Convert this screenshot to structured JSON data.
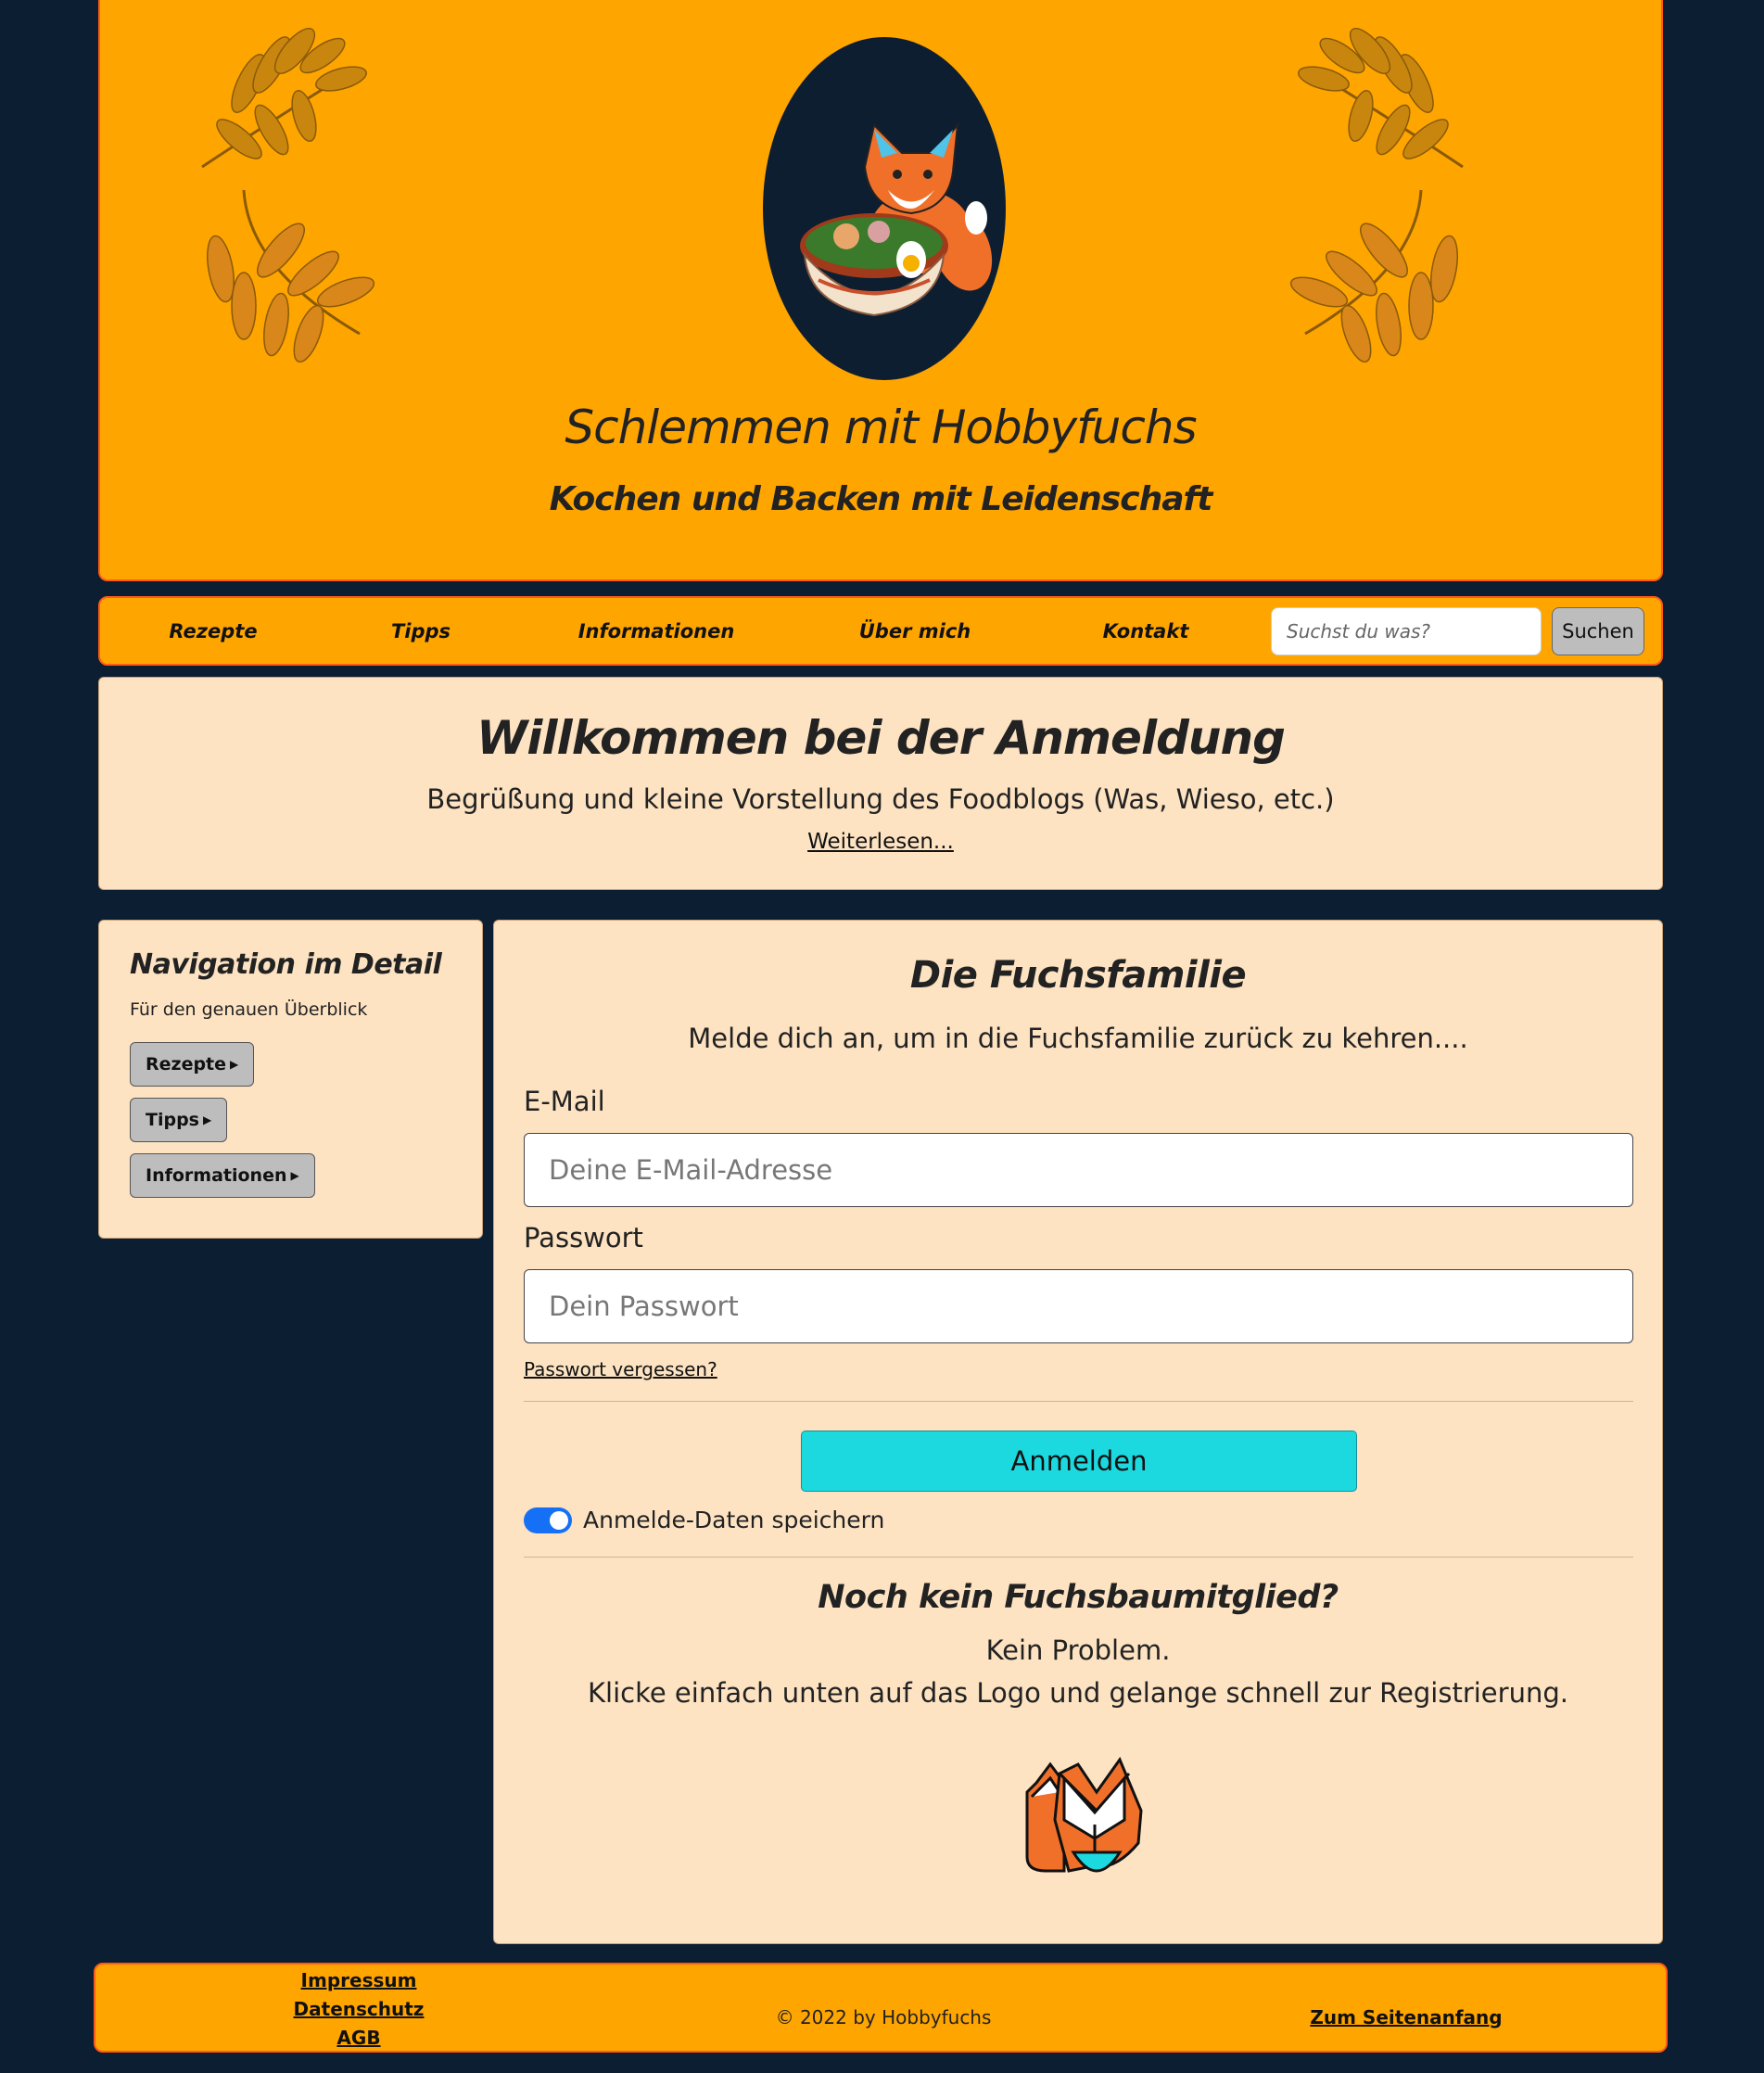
{
  "header": {
    "title": "Schlemmen mit Hobbyfuchs",
    "subtitle": "Kochen und Backen mit Leidenschaft",
    "logo_icon": "fox-eating-ramen-logo",
    "decoration_icon": "autumn-leaves"
  },
  "nav": {
    "items": [
      {
        "label": "Rezepte"
      },
      {
        "label": "Tipps"
      },
      {
        "label": "Informationen"
      },
      {
        "label": "Über mich"
      },
      {
        "label": "Kontakt"
      }
    ],
    "search_placeholder": "Suchst du was?",
    "search_button": "Suchen"
  },
  "welcome": {
    "title": "Willkommen bei der Anmeldung",
    "text": "Begrüßung und kleine Vorstellung des Foodblogs (Was, Wieso, etc.)",
    "link": "Weiterlesen..."
  },
  "sidebar": {
    "title": "Navigation im Detail",
    "subtitle": "Für den genauen Überblick",
    "buttons": [
      {
        "label": "Rezepte"
      },
      {
        "label": "Tipps"
      },
      {
        "label": "Informationen"
      }
    ]
  },
  "login": {
    "title": "Die Fuchsfamilie",
    "intro": "Melde dich an, um in die Fuchsfamilie zurück zu kehren....",
    "email_label": "E-Mail",
    "email_placeholder": "Deine E-Mail-Adresse",
    "password_label": "Passwort",
    "password_placeholder": "Dein Passwort",
    "forgot_link": "Passwort vergessen?",
    "submit": "Anmelden",
    "remember_label": "Anmelde-Daten speichern",
    "remember_on": true
  },
  "signup": {
    "title": "Noch kein Fuchsbaumitglied?",
    "line1": "Kein Problem.",
    "line2": "Klicke einfach unten auf das Logo und gelange schnell zur Registrierung.",
    "logo_icon": "fox-family-logo"
  },
  "footer": {
    "links": [
      {
        "label": "Impressum"
      },
      {
        "label": "Datenschutz"
      },
      {
        "label": "AGB"
      }
    ],
    "copyright": "© 2022 by Hobbyfuchs",
    "top_link": "Zum Seitenanfang"
  },
  "colors": {
    "background": "#0c1e31",
    "header": "#ffa500",
    "card": "#fde3c2",
    "primary_button": "#1cd9e0",
    "toggle": "#1670f5"
  }
}
